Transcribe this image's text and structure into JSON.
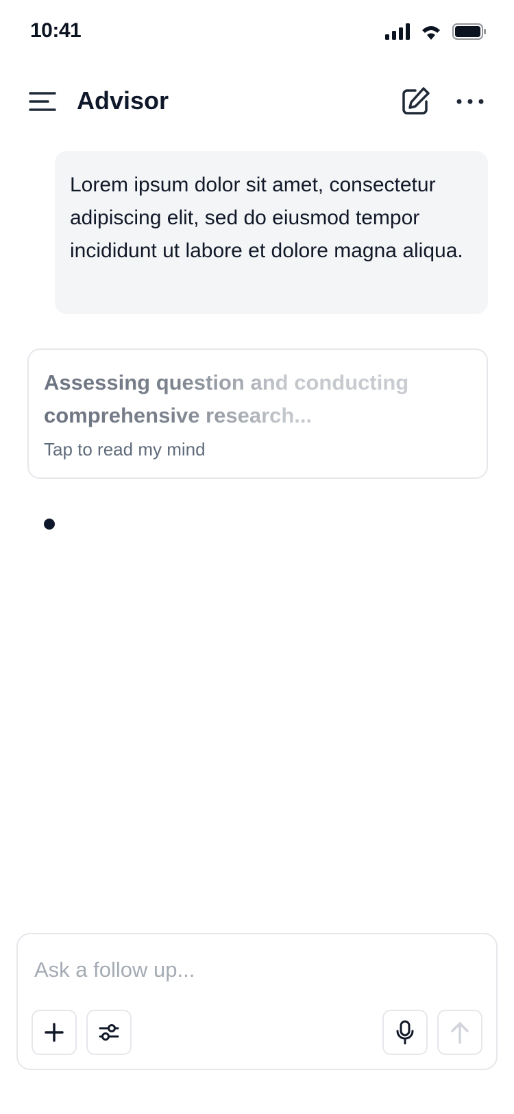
{
  "status_bar": {
    "time": "10:41"
  },
  "header": {
    "title": "Advisor"
  },
  "user_message": {
    "text": "Lorem ipsum dolor sit amet, consectetur adipiscing elit, sed do eiusmod tempor incididunt ut labore et dolore magna aliqua."
  },
  "thinking": {
    "status": "Assessing question and conducting comprehensive research...",
    "hint": "Tap to read my mind"
  },
  "composer": {
    "placeholder": "Ask a follow up..."
  },
  "icons": [
    "menu-icon",
    "compose-icon",
    "more-icon",
    "plus-icon",
    "sliders-icon",
    "microphone-icon",
    "arrow-up-icon",
    "signal-icon",
    "wifi-icon",
    "battery-icon"
  ],
  "colors": {
    "text": "#0f172a",
    "bubble": "#f3f5f7",
    "border": "#e5e7eb",
    "placeholder": "#a5abb4",
    "muted": "#5f6b7a"
  }
}
